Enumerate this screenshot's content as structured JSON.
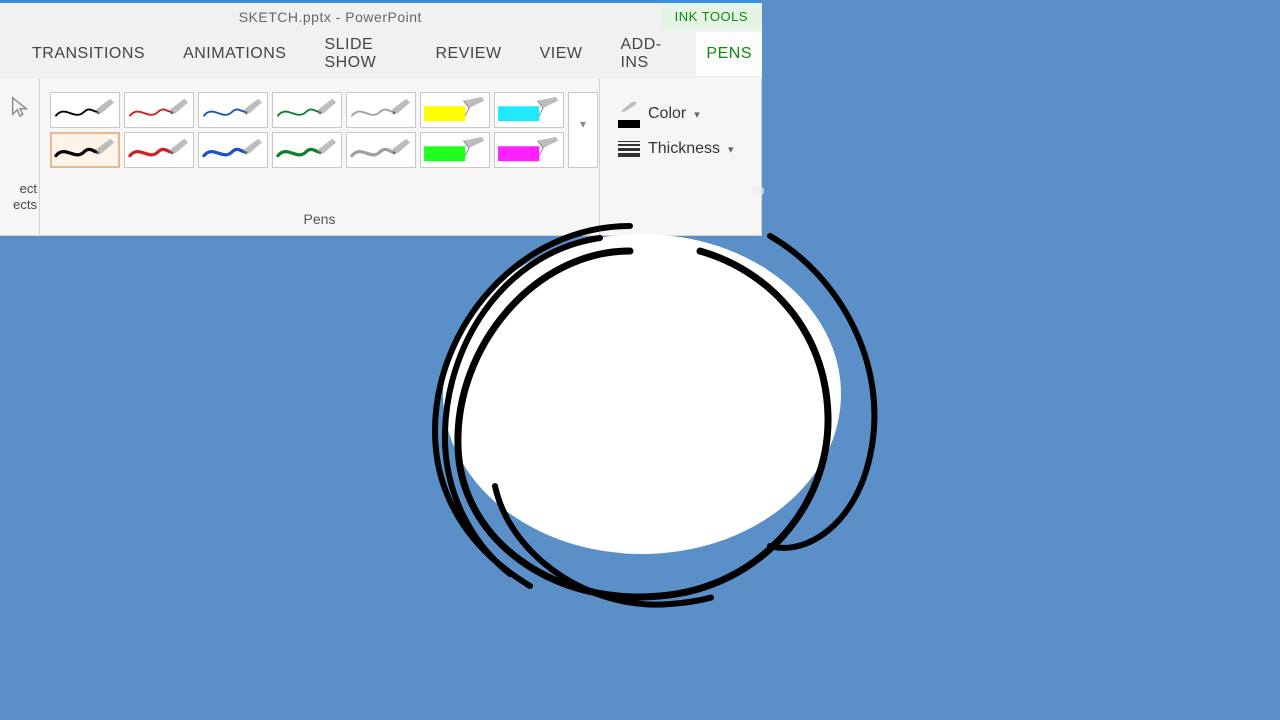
{
  "title": "SKETCH.pptx - PowerPoint",
  "ink_tools_label": "INK TOOLS",
  "tabs": {
    "transitions": "TRANSITIONS",
    "animations": "ANIMATIONS",
    "slideshow": "SLIDE SHOW",
    "review": "REVIEW",
    "view": "VIEW",
    "addins": "ADD-INS",
    "pens": "PENS"
  },
  "ribbon": {
    "select_partial_1": "ect",
    "select_partial_2": "ects",
    "pens_label": "Pens",
    "color_label": "Color",
    "thickness_label": "Thickness",
    "behind_fragment": "to"
  },
  "pens": [
    {
      "stroke": "#000000",
      "fill": "none",
      "type": "pen"
    },
    {
      "stroke": "#d02020",
      "fill": "none",
      "type": "pen"
    },
    {
      "stroke": "#2050c0",
      "fill": "none",
      "type": "pen"
    },
    {
      "stroke": "#108030",
      "fill": "none",
      "type": "pen"
    },
    {
      "stroke": "#a0a0a0",
      "fill": "none",
      "type": "pen"
    },
    {
      "stroke": "none",
      "fill": "#ffff00",
      "type": "highlighter"
    },
    {
      "stroke": "none",
      "fill": "#20e8ff",
      "type": "highlighter"
    },
    {
      "stroke": "#000000",
      "fill": "none",
      "type": "pen"
    },
    {
      "stroke": "#d02020",
      "fill": "none",
      "type": "pen"
    },
    {
      "stroke": "#2050c0",
      "fill": "none",
      "type": "pen"
    },
    {
      "stroke": "#108030",
      "fill": "none",
      "type": "pen"
    },
    {
      "stroke": "#a0a0a0",
      "fill": "none",
      "type": "pen"
    },
    {
      "stroke": "none",
      "fill": "#20ff20",
      "type": "highlighter"
    },
    {
      "stroke": "none",
      "fill": "#ff20ff",
      "type": "highlighter"
    }
  ],
  "pens_selected_index": 7,
  "canvas_bg": "#5a8fc7"
}
